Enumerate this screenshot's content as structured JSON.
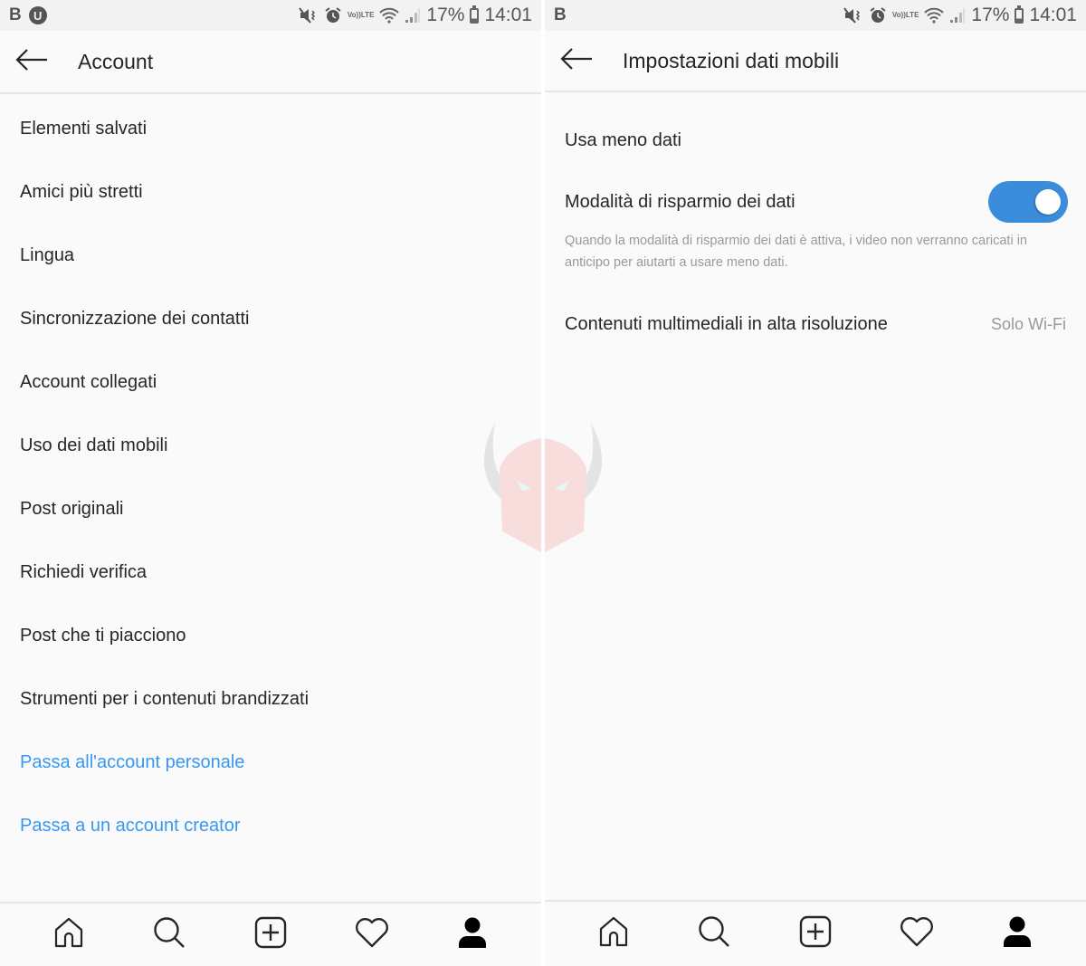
{
  "left": {
    "status_bar": {
      "carrier": "B",
      "badge": "U",
      "volte_top": "Vo))",
      "volte_bottom": "LTE",
      "battery_percent": "17%",
      "time": "14:01",
      "icons": [
        "mute-vibrate-icon",
        "alarm-icon",
        "volte-icon",
        "wifi-icon",
        "signal-icon",
        "battery-icon"
      ]
    },
    "header": {
      "back_icon": "arrow-left-icon",
      "title": "Account"
    },
    "menu": [
      {
        "label": "Elementi salvati",
        "type": "item"
      },
      {
        "label": "Amici più stretti",
        "type": "item"
      },
      {
        "label": "Lingua",
        "type": "item"
      },
      {
        "label": "Sincronizzazione dei contatti",
        "type": "item"
      },
      {
        "label": "Account collegati",
        "type": "item"
      },
      {
        "label": "Uso dei dati mobili",
        "type": "item"
      },
      {
        "label": "Post originali",
        "type": "item"
      },
      {
        "label": "Richiedi verifica",
        "type": "item"
      },
      {
        "label": "Post che ti piacciono",
        "type": "item"
      },
      {
        "label": "Strumenti per i contenuti brandizzati",
        "type": "item"
      },
      {
        "label": "Passa all'account personale",
        "type": "link"
      },
      {
        "label": "Passa a un account creator",
        "type": "link"
      }
    ],
    "tab_bar": [
      "home-icon",
      "search-icon",
      "add-post-icon",
      "activity-heart-icon",
      "profile-icon"
    ]
  },
  "right": {
    "status_bar": {
      "carrier": "B",
      "volte_top": "Vo))",
      "volte_bottom": "LTE",
      "battery_percent": "17%",
      "time": "14:01",
      "icons": [
        "mute-vibrate-icon",
        "alarm-icon",
        "volte-icon",
        "wifi-icon",
        "signal-icon",
        "battery-icon"
      ]
    },
    "header": {
      "back_icon": "arrow-left-icon",
      "title": "Impostazioni dati mobili"
    },
    "settings": {
      "use_less_data": "Usa meno dati",
      "data_saver_label": "Modalità di risparmio dei dati",
      "data_saver_enabled": true,
      "data_saver_description": "Quando la modalità di risparmio dei dati è attiva, i video non verranno caricati in anticipo per aiutarti a usare meno dati.",
      "high_res_label": "Contenuti multimediali in alta risoluzione",
      "high_res_value": "Solo Wi-Fi"
    },
    "tab_bar": [
      "home-icon",
      "search-icon",
      "add-post-icon",
      "activity-heart-icon",
      "profile-icon"
    ]
  },
  "colors": {
    "text_primary": "#262626",
    "text_secondary": "#999999",
    "link_blue": "#3897f0",
    "toggle_on": "#3b8ddb",
    "background": "#fafafa",
    "status_bar": "#f2f2f2"
  },
  "watermark": "horned-helmet-logo"
}
